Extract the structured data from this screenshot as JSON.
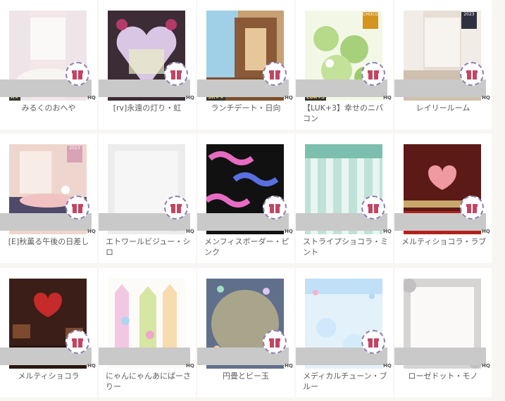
{
  "items": [
    {
      "label": "みるくのおへや",
      "rarity": "R★",
      "hq": "HQ"
    },
    {
      "label": "[rv]永遠の灯り・虹",
      "hq": "HQ"
    },
    {
      "label": "ランチデート・日向",
      "rarity": "SR★★",
      "hq": "HQ"
    },
    {
      "label": "【LUK+3】幸せのニパコン",
      "rarity": "LUK+3",
      "badge": "CHOCO",
      "hq": "HQ"
    },
    {
      "label": "レイリールーム",
      "badge": "2023",
      "hq": "HQ"
    },
    {
      "label": "[E]秋薫る午後の日差し",
      "badge": "2023",
      "hq": "HQ"
    },
    {
      "label": "エトワールビジュー・シロ",
      "hq": "HQ"
    },
    {
      "label": "メンフィスボーダー・ピンク",
      "hq": "HQ"
    },
    {
      "label": "ストライプショコラ・ミント",
      "hq": "HQ"
    },
    {
      "label": "メルティショコラ・ラブ",
      "hq": "HQ"
    },
    {
      "label": "メルティショコラ",
      "hq": "HQ"
    },
    {
      "label": "にゃんにゃんあにばーさりー",
      "hq": "HQ"
    },
    {
      "label": "円畳とビー玉",
      "hq": "HQ"
    },
    {
      "label": "メディカルチューン・ブルー",
      "hq": "HQ"
    },
    {
      "label": "ローゼドット・モノ",
      "hq": "HQ"
    }
  ]
}
